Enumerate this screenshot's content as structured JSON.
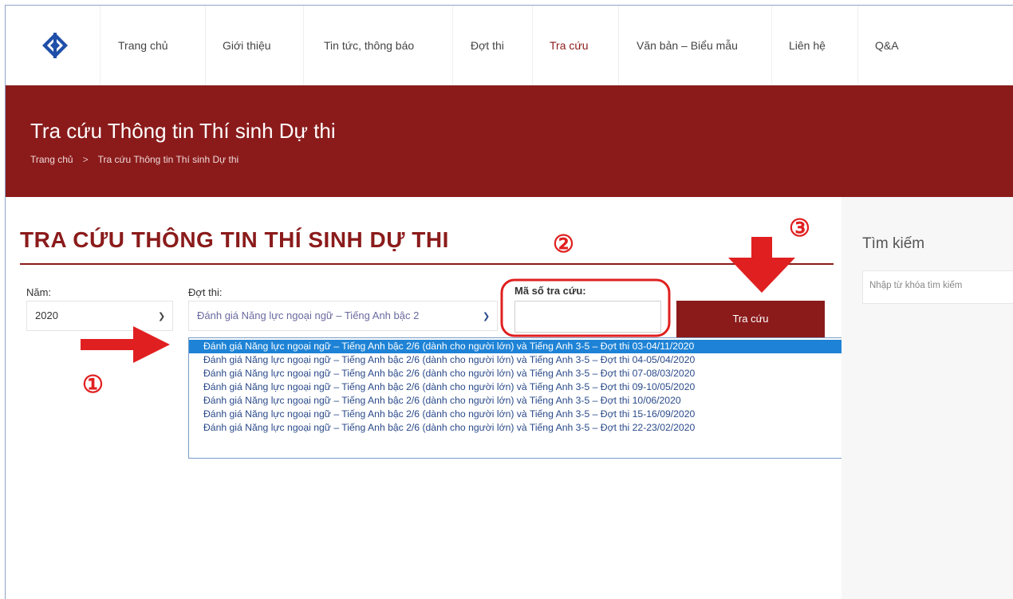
{
  "nav": {
    "items": [
      "Trang chủ",
      "Giới thiệu",
      "Tin tức, thông báo",
      "Đợt thi",
      "Tra cứu",
      "Văn bản – Biểu mẫu",
      "Liên hệ",
      "Q&A"
    ],
    "active_index": 4
  },
  "banner": {
    "title": "Tra cứu Thông tin Thí sinh Dự thi",
    "breadcrumb_home": "Trang chủ",
    "breadcrumb_sep": ">",
    "breadcrumb_current": "Tra cứu Thông tin Thí sinh Dự thi"
  },
  "main": {
    "heading": "TRA CỨU THÔNG TIN THÍ SINH DỰ THI",
    "year_label": "Năm:",
    "year_value": "2020",
    "session_label": "Đợt thi:",
    "session_value": "Đánh giá Năng lực ngoại ngữ – Tiếng Anh bậc 2",
    "code_label": "Mã số tra cứu:",
    "code_value": "",
    "search_button": "Tra cứu",
    "dropdown_options": [
      "Đánh giá Năng lực ngoại ngữ – Tiếng Anh bậc 2/6 (dành cho người lớn) và Tiếng Anh 3-5 – Đợt thi 03-04/11/2020",
      "Đánh giá Năng lực ngoại ngữ – Tiếng Anh bậc 2/6 (dành cho người lớn) và Tiếng Anh 3-5 – Đợt thi 04-05/04/2020",
      "Đánh giá Năng lực ngoại ngữ – Tiếng Anh bậc 2/6 (dành cho người lớn) và Tiếng Anh 3-5 – Đợt thi 07-08/03/2020",
      "Đánh giá Năng lực ngoại ngữ – Tiếng Anh bậc 2/6 (dành cho người lớn) và Tiếng Anh 3-5 – Đợt thi 09-10/05/2020",
      "Đánh giá Năng lực ngoại ngữ – Tiếng Anh bậc 2/6 (dành cho người lớn) và Tiếng Anh 3-5 – Đợt thi 10/06/2020",
      "Đánh giá Năng lực ngoại ngữ – Tiếng Anh bậc 2/6 (dành cho người lớn) và Tiếng Anh 3-5 – Đợt thi 15-16/09/2020",
      "Đánh giá Năng lực ngoại ngữ – Tiếng Anh bậc 2/6 (dành cho người lớn) và Tiếng Anh 3-5 – Đợt thi 22-23/02/2020"
    ],
    "selected_option_index": 0
  },
  "sidebar": {
    "title": "Tìm kiếm",
    "search_placeholder": "Nhập từ khóa tìm kiếm"
  },
  "annotations": {
    "step1": "①",
    "step2": "②",
    "step3": "③"
  },
  "colors": {
    "brand": "#8b1b1b",
    "annotation": "#e02020",
    "selected_option": "#1e83d6"
  },
  "icons": {
    "logo": "diamond-logo-icon",
    "select_chevron": "chevron-down-icon"
  }
}
